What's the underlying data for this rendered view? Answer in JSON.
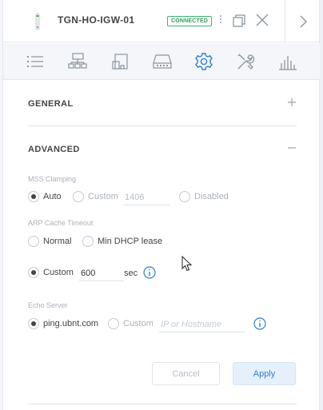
{
  "header": {
    "device_name": "TGN-HO-IGW-01",
    "status": "CONNECTED",
    "icons": [
      "device-icon",
      "more-icon",
      "restore-icon",
      "close-icon",
      "chevron-right-icon"
    ]
  },
  "toolbar": {
    "tools": [
      "list-icon",
      "topology-icon",
      "ports-icon",
      "device-storage-icon",
      "settings-icon",
      "tools-icon",
      "statistics-icon"
    ],
    "active": "settings-icon"
  },
  "sections": {
    "general": {
      "title": "GENERAL",
      "toggle": "+"
    },
    "advanced": {
      "title": "ADVANCED",
      "toggle": "−"
    }
  },
  "mss": {
    "label": "MSS Clamping",
    "auto": "Auto",
    "custom": "Custom",
    "value": "1406",
    "disabled": "Disabled",
    "selected": "auto"
  },
  "arp": {
    "label": "ARP Cache Timeout",
    "normal": "Normal",
    "min_dhcp": "Min DHCP lease",
    "custom": "Custom",
    "value": "600",
    "unit": "sec",
    "selected": "custom"
  },
  "echo": {
    "label": "Echo Server",
    "default": "ping.ubnt.com",
    "custom": "Custom",
    "placeholder": "IP or Hostname",
    "selected": "default"
  },
  "actions": {
    "cancel": "Cancel",
    "apply": "Apply"
  },
  "colors": {
    "accent": "#2f7fd1",
    "connected": "#2e9e58",
    "toolbar_bg": "#f4f6f9"
  }
}
